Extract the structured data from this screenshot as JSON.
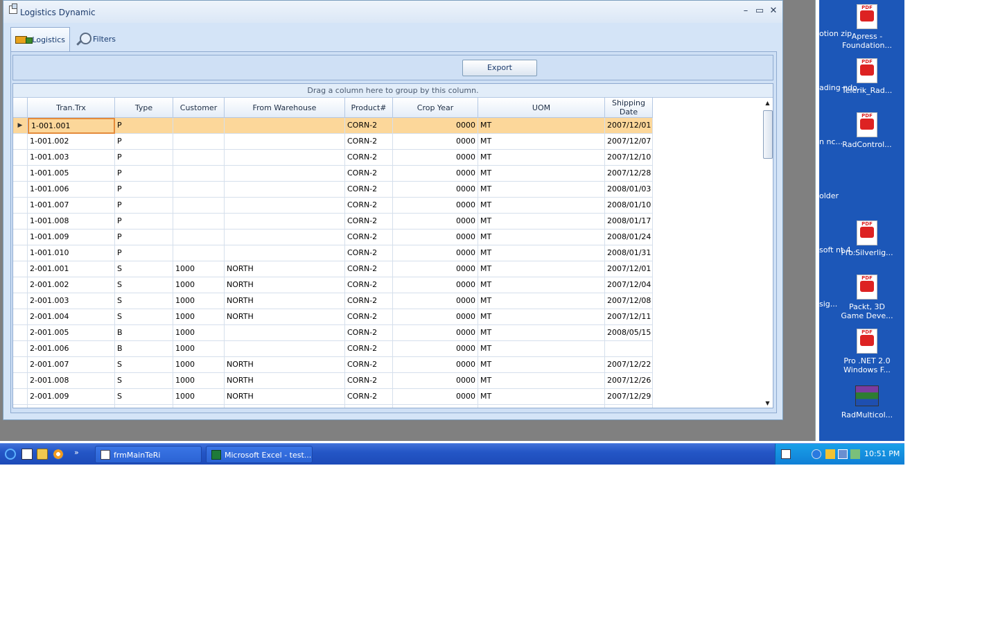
{
  "window": {
    "title": "Logistics Dynamic",
    "minimize": "–",
    "maximize": "▭",
    "close": "✕"
  },
  "tabs": [
    {
      "label": "Logistics",
      "icon": "truck-icon"
    },
    {
      "label": "Filters",
      "icon": "magnifier-icon"
    }
  ],
  "toolbar": {
    "export_label": "Export"
  },
  "grid": {
    "group_panel_text": "Drag a column here to group by this column.",
    "columns": [
      "Tran.Trx",
      "Type",
      "Customer",
      "From Warehouse",
      "Product#",
      "Crop Year",
      "UOM",
      "Shipping Date"
    ],
    "current_row_indicator": "▶",
    "rows": [
      [
        "1-001.001",
        "P",
        "",
        "",
        "CORN-2",
        "0000",
        "MT",
        "2007/12/01"
      ],
      [
        "1-001.002",
        "P",
        "",
        "",
        "CORN-2",
        "0000",
        "MT",
        "2007/12/07"
      ],
      [
        "1-001.003",
        "P",
        "",
        "",
        "CORN-2",
        "0000",
        "MT",
        "2007/12/10"
      ],
      [
        "1-001.005",
        "P",
        "",
        "",
        "CORN-2",
        "0000",
        "MT",
        "2007/12/28"
      ],
      [
        "1-001.006",
        "P",
        "",
        "",
        "CORN-2",
        "0000",
        "MT",
        "2008/01/03"
      ],
      [
        "1-001.007",
        "P",
        "",
        "",
        "CORN-2",
        "0000",
        "MT",
        "2008/01/10"
      ],
      [
        "1-001.008",
        "P",
        "",
        "",
        "CORN-2",
        "0000",
        "MT",
        "2008/01/17"
      ],
      [
        "1-001.009",
        "P",
        "",
        "",
        "CORN-2",
        "0000",
        "MT",
        "2008/01/24"
      ],
      [
        "1-001.010",
        "P",
        "",
        "",
        "CORN-2",
        "0000",
        "MT",
        "2008/01/31"
      ],
      [
        "2-001.001",
        "S",
        "1000",
        "NORTH",
        "CORN-2",
        "0000",
        "MT",
        "2007/12/01"
      ],
      [
        "2-001.002",
        "S",
        "1000",
        "NORTH",
        "CORN-2",
        "0000",
        "MT",
        "2007/12/04"
      ],
      [
        "2-001.003",
        "S",
        "1000",
        "NORTH",
        "CORN-2",
        "0000",
        "MT",
        "2007/12/08"
      ],
      [
        "2-001.004",
        "S",
        "1000",
        "NORTH",
        "CORN-2",
        "0000",
        "MT",
        "2007/12/11"
      ],
      [
        "2-001.005",
        "B",
        "1000",
        "",
        "CORN-2",
        "0000",
        "MT",
        "2008/05/15"
      ],
      [
        "2-001.006",
        "B",
        "1000",
        "",
        "CORN-2",
        "0000",
        "MT",
        ""
      ],
      [
        "2-001.007",
        "S",
        "1000",
        "NORTH",
        "CORN-2",
        "0000",
        "MT",
        "2007/12/22"
      ],
      [
        "2-001.008",
        "S",
        "1000",
        "NORTH",
        "CORN-2",
        "0000",
        "MT",
        "2007/12/26"
      ],
      [
        "2-001.009",
        "S",
        "1000",
        "NORTH",
        "CORN-2",
        "0000",
        "MT",
        "2007/12/29"
      ]
    ],
    "selected_row": 0
  },
  "desktop": {
    "icons": [
      {
        "label": "Apress - Foundation...",
        "icon": "pdf-icon"
      },
      {
        "label": "Telerik_Rad...",
        "icon": "pdf-icon"
      },
      {
        "label": "RadControl...",
        "icon": "pdf-icon"
      },
      {
        "label": "Pro.Silverlig...",
        "icon": "pdf-icon"
      },
      {
        "label": "Packt, 3D Game Deve...",
        "icon": "pdf-icon"
      },
      {
        "label": "Pro .NET 2.0 Windows F...",
        "icon": "pdf-icon"
      },
      {
        "label": "RadMulticol...",
        "icon": "winrar-icon"
      }
    ],
    "cut_labels": [
      "otion zip",
      "ading ndo...",
      "n nc...",
      "older",
      "soft nt 4...",
      "sig..."
    ]
  },
  "taskbar": {
    "quick_launch_more": "»",
    "tasks": [
      {
        "label": "frmMainTeRi"
      },
      {
        "label": "Microsoft Excel - test..."
      }
    ],
    "clock": "10:51 PM"
  },
  "colors": {
    "window_bg": "#d4e4f7",
    "selected_row": "#fcd79a",
    "desktop_blue": "#1c57b8",
    "taskbar": "#2456c6"
  }
}
